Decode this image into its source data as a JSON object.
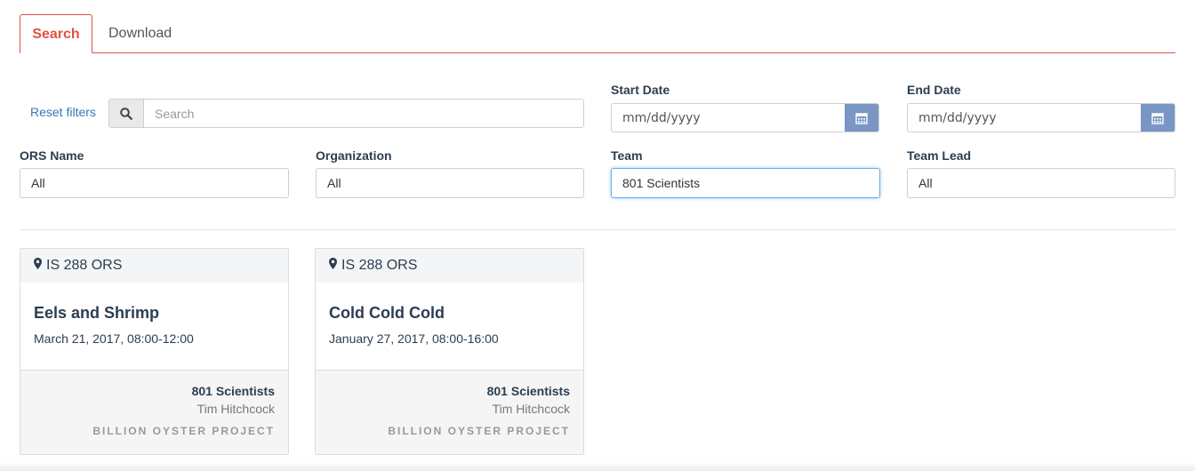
{
  "tabs": [
    {
      "label": "Search",
      "active": true
    },
    {
      "label": "Download",
      "active": false
    }
  ],
  "filters": {
    "reset_label": "Reset filters",
    "search_placeholder": "Search",
    "start_date": {
      "label": "Start Date",
      "placeholder": "mm/dd/yyyy"
    },
    "end_date": {
      "label": "End Date",
      "placeholder": "mm/dd/yyyy"
    },
    "ors_name": {
      "label": "ORS Name",
      "value": "All"
    },
    "organization": {
      "label": "Organization",
      "value": "All"
    },
    "team": {
      "label": "Team",
      "value": "801 Scientists"
    },
    "team_lead": {
      "label": "Team Lead",
      "value": "All"
    }
  },
  "cards": [
    {
      "location": "IS 288 ORS",
      "title": "Eels and Shrimp",
      "datetime": "March 21, 2017, 08:00-12:00",
      "team": "801 Scientists",
      "lead": "Tim Hitchcock",
      "organization": "BILLION OYSTER PROJECT"
    },
    {
      "location": "IS 288 ORS",
      "title": "Cold Cold Cold",
      "datetime": "January 27, 2017, 08:00-16:00",
      "team": "801 Scientists",
      "lead": "Tim Hitchcock",
      "organization": "BILLION OYSTER PROJECT"
    }
  ],
  "colors": {
    "accent": "#e0533d",
    "link": "#337ab7",
    "calendar_button": "#7996c5"
  },
  "icons": {
    "search": "search-icon",
    "calendar": "calendar-icon",
    "location": "map-marker-icon"
  }
}
